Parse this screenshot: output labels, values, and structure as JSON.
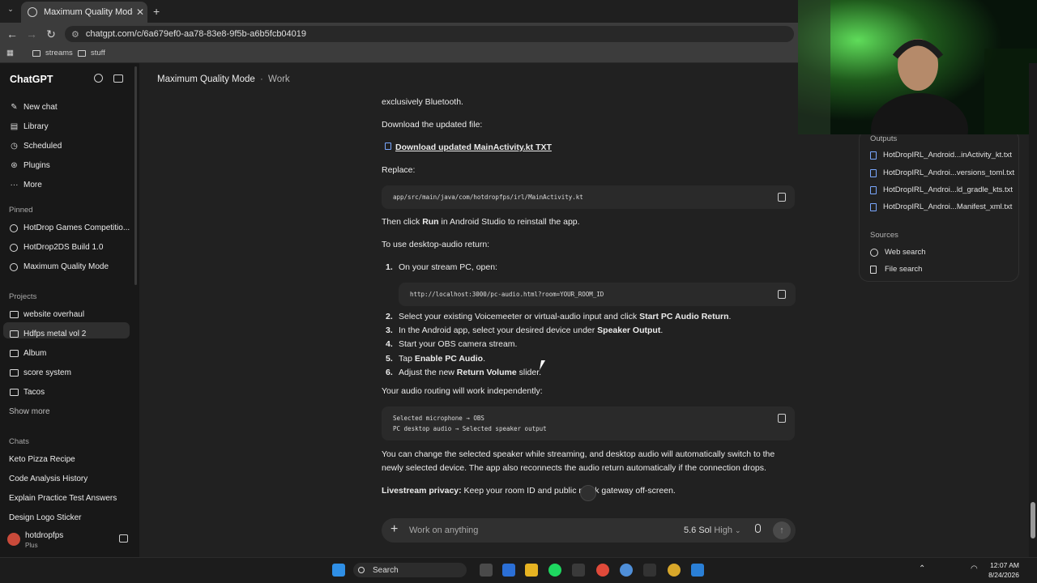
{
  "browser": {
    "tab_title": "Maximum Quality Mode",
    "new_tab": "+",
    "url": "chatgpt.com/c/6a679ef0-aa78-83e8-9f5b-a6b5fcb04019",
    "bookmarks": [
      "streams",
      "stuff"
    ]
  },
  "sidebar": {
    "brand": "ChatGPT",
    "nav": [
      {
        "label": "New chat",
        "icon": "pencil-icon"
      },
      {
        "label": "Library",
        "icon": "library-icon"
      },
      {
        "label": "Scheduled",
        "icon": "clock-icon"
      },
      {
        "label": "Plugins",
        "icon": "plugins-icon"
      },
      {
        "label": "More",
        "icon": "more-icon"
      }
    ],
    "pinned_heading": "Pinned",
    "pinned": [
      "HotDrop Games Competitio...",
      "HotDrop2DS Build 1.0",
      "Maximum Quality Mode"
    ],
    "projects_heading": "Projects",
    "projects": [
      "website overhaul",
      "Hdfps metal vol 2",
      "Album",
      "score system",
      "Tacos"
    ],
    "show_more": "Show more",
    "chats_heading": "Chats",
    "chats": [
      "Keto Pizza Recipe",
      "Code Analysis History",
      "Explain Practice Test Answers",
      "Design Logo Sticker"
    ],
    "user_name": "hotdropfps",
    "user_plan": "Plus"
  },
  "header": {
    "title": "Maximum Quality Mode",
    "separator": "·",
    "subtitle": "Work"
  },
  "content": {
    "p1": "exclusively Bluetooth.",
    "p2": "Download the updated file:",
    "download_link": "Download updated MainActivity.kt TXT",
    "replace": "Replace:",
    "code1": "app/src/main/java/com/hotdropfps/irl/MainActivity.kt",
    "then_click_pre": "Then click ",
    "then_click_bold": "Run",
    "then_click_post": " in Android Studio to reinstall the app.",
    "desktop_audio": "To use desktop-audio return:",
    "step1_pre": "On your stream PC, open:",
    "code2": "http://localhost:3000/pc-audio.html?room=YOUR_ROOM_ID",
    "steps": [
      {
        "num": "1.",
        "pre": "On your stream PC, open:",
        "bold": "",
        "post": ""
      },
      {
        "num": "2.",
        "pre": "Select your existing Voicemeeter or virtual-audio input and click ",
        "bold": "Start PC Audio Return",
        "post": "."
      },
      {
        "num": "3.",
        "pre": "In the Android app, select your desired device under ",
        "bold": "Speaker Output",
        "post": "."
      },
      {
        "num": "4.",
        "pre": "Start your OBS camera stream.",
        "bold": "",
        "post": ""
      },
      {
        "num": "5.",
        "pre": "Tap ",
        "bold": "Enable PC Audio",
        "post": "."
      },
      {
        "num": "6.",
        "pre": "Adjust the new ",
        "bold": "Return Volume",
        "post": " slider."
      }
    ],
    "routing": "Your audio routing will work independently:",
    "code3_line1": "Selected microphone → OBS",
    "code3_line2": "PC desktop audio → Selected speaker output",
    "change_line1": "You can change the selected speaker while streaming, and desktop audio will automatically switch to the",
    "change_line2": "newly selected device. The app also reconnects the audio return automatically if the connection drops.",
    "privacy_bold": "Livestream privacy:",
    "privacy_post": " Keep your room ID and public m   ↓  k gateway off-screen."
  },
  "composer": {
    "plus": "+",
    "placeholder": "Work on anything",
    "model": "5.6 Sol",
    "mode": "High"
  },
  "panel": {
    "outputs_heading": "Outputs",
    "outputs": [
      "HotDropIRL_Android...inActivity_kt.txt",
      "HotDropIRL_Androi...versions_toml.txt",
      "HotDropIRL_Androi...ld_gradle_kts.txt",
      "HotDropIRL_Androi...Manifest_xml.txt"
    ],
    "sources_heading": "Sources",
    "sources": [
      {
        "label": "Web search",
        "icon": "globe-icon"
      },
      {
        "label": "File search",
        "icon": "file-icon"
      }
    ]
  },
  "taskbar": {
    "search": "Search",
    "time": "12:07 AM",
    "date": "8/24/2026"
  },
  "colors": {
    "background": "#212121",
    "sidebar": "#181818",
    "accent_link": "#7aa8ff"
  }
}
